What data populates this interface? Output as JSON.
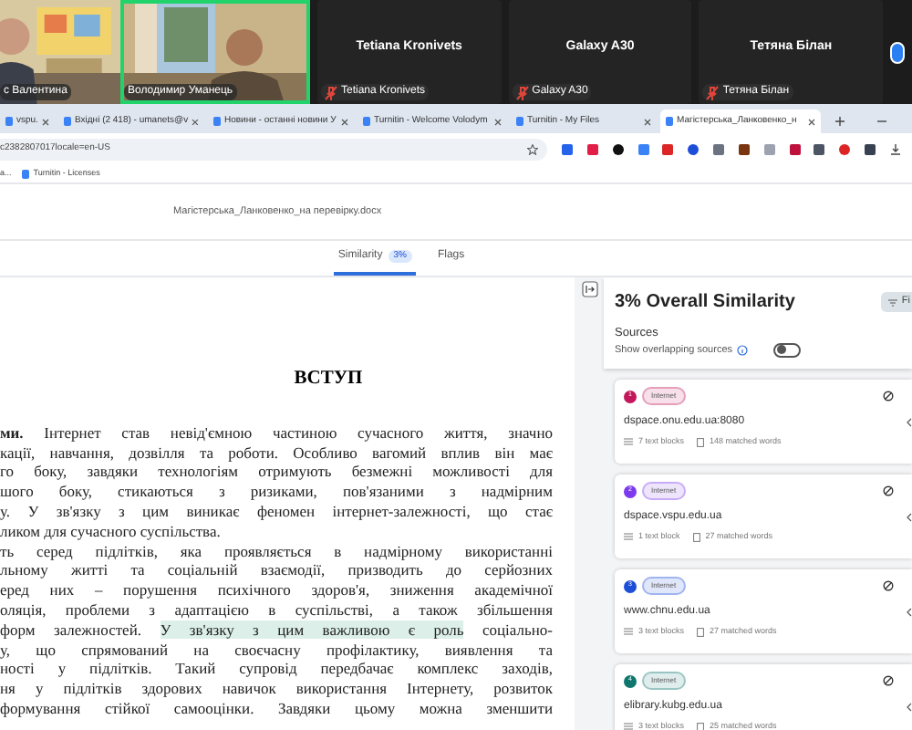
{
  "video_tiles": [
    {
      "name": "с Валентина",
      "active": false
    },
    {
      "name": "Володимир Уманець",
      "active": true
    }
  ],
  "participants": [
    {
      "display_name": "Tetiana Kronivets",
      "label": "Tetiana Kronivets",
      "muted": true
    },
    {
      "display_name": "Galaxy A30",
      "label": "Galaxy A30",
      "muted": true
    },
    {
      "display_name": "Тетяна Білан",
      "label": "Тетяна Білан",
      "muted": true
    }
  ],
  "browser": {
    "tabs": [
      {
        "title": "vspu.",
        "selected": false
      },
      {
        "title": "Вхідні (2 418) - umanets@v",
        "selected": false
      },
      {
        "title": "Новини - останні новини У",
        "selected": false
      },
      {
        "title": "Turnitin - Welcome Volodym",
        "selected": false
      },
      {
        "title": "Turnitin - My Files",
        "selected": false
      },
      {
        "title": "Магістерська_Ланковенко_н",
        "selected": true
      }
    ],
    "url": "c2382807017locale=en-US",
    "bookmarks": [
      "a...",
      "Turnitin - Licenses"
    ]
  },
  "document_header": {
    "file_name": "Магістерська_Ланковенко_на перевірку.docx"
  },
  "view_tabs": [
    {
      "label": "Similarity",
      "badge": "3%",
      "selected": true
    },
    {
      "label": "Flags",
      "selected": false
    }
  ],
  "document": {
    "heading": "ВСТУП",
    "lines": [
      [
        {
          "text": "**ми.** Інтернет став невід'ємною частиною сучасного життя, значно",
          "highlighted": false
        }
      ],
      [
        {
          "text": "кації, навчання, дозвілля та роботи. Особливо вагомий вплив він має",
          "highlighted": false
        }
      ],
      [
        {
          "text": "го боку, завдяки технологіям отримують безмежні можливості для",
          "highlighted": false
        }
      ],
      [
        {
          "text": "шого боку, стикаються з ризиками, пов'язаними з надмірним",
          "highlighted": false
        }
      ],
      [
        {
          "text": "у. У зв'язку з цим виникає феномен інтернет-залежності, що стає",
          "highlighted": false
        }
      ],
      {
        "kind": "paragraph-end",
        "segments": [
          {
            "text": "ликом для сучасного суспільства.",
            "highlighted": false
          }
        ]
      },
      [
        {
          "text": "ть серед підлітків, яка проявляється в надмірному використанні",
          "highlighted": false
        }
      ],
      [
        {
          "text": "льному житті та соціальній взаємодії, призводить до серйозних",
          "highlighted": false
        }
      ],
      [
        {
          "text": "еред них – порушення психічного здоров'я, зниження академічної",
          "highlighted": false
        }
      ],
      [
        {
          "text": "оляція, проблеми з адаптацією в суспільстві, а також збільшення",
          "highlighted": false
        }
      ],
      [
        {
          "text": "форм залежностей. ",
          "highlighted": false
        },
        {
          "text": "У зв'язку з цим важливою є роль",
          "highlighted": true
        },
        {
          "text": " соціально-",
          "highlighted": false
        }
      ],
      [
        {
          "text": "у, що спрямований на своєчасну профілактику, виявлення та",
          "highlighted": false
        }
      ],
      [
        {
          "text": "ності у підлітків. Такий супровід передбачає комплекс заходів,",
          "highlighted": false
        }
      ],
      [
        {
          "text": "ня у підлітків здорових навичок використання Інтернету, розвиток",
          "highlighted": false
        }
      ],
      [
        {
          "text": "формування стійкої самооцінки. Завдяки цьому можна зменшити",
          "highlighted": false
        }
      ]
    ]
  },
  "similarity_panel": {
    "title": "3% Overall Similarity",
    "filter_button": "Fi",
    "sources_label": "Sources",
    "overlap_label": "Show overlapping sources",
    "overlap_on": false,
    "sources": [
      {
        "number": "1",
        "color": "#c2185b",
        "tag": "Internet",
        "domain": "dspace.onu.edu.ua:8080",
        "blocks": "7 text blocks",
        "words": "148 matched words"
      },
      {
        "number": "2",
        "color": "#7c3aed",
        "tag": "Internet",
        "domain": "dspace.vspu.edu.ua",
        "blocks": "1 text block",
        "words": "27 matched words"
      },
      {
        "number": "3",
        "color": "#1d4ed8",
        "tag": "Internet",
        "domain": "www.chnu.edu.ua",
        "blocks": "3 text blocks",
        "words": "27 matched words"
      },
      {
        "number": "4",
        "color": "#0f766e",
        "tag": "Internet",
        "domain": "elibrary.kubg.edu.ua",
        "blocks": "3 text blocks",
        "words": "25 matched words"
      }
    ]
  }
}
